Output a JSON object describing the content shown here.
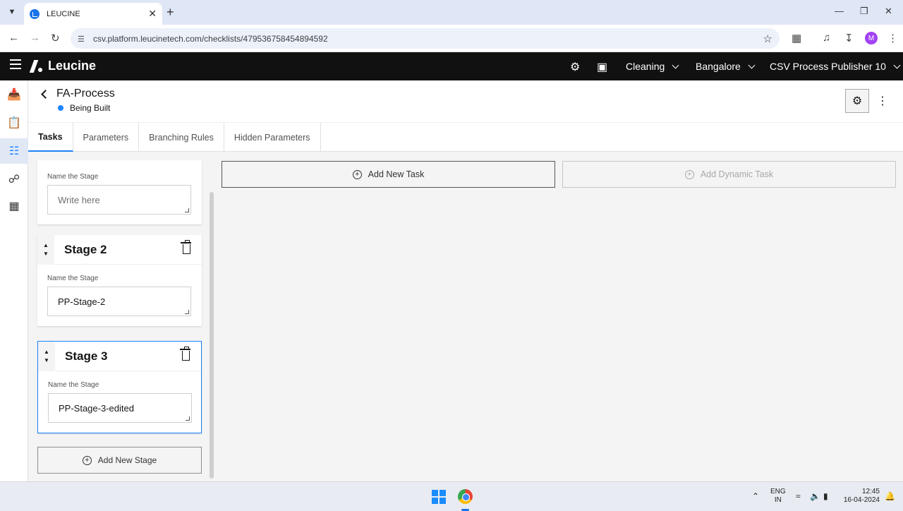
{
  "browser": {
    "tab_title": "LEUCINE",
    "url": "csv.platform.leucinetech.com/checklists/479536758454894592",
    "profile_initial": "M"
  },
  "app": {
    "logo_text": "Leucine",
    "header": {
      "use_case": "Cleaning",
      "facility": "Bangalore",
      "user": "CSV Process Publisher 10"
    }
  },
  "process": {
    "title": "FA-Process",
    "status": "Being Built",
    "status_color": "#1d84ff"
  },
  "tabs": [
    {
      "label": "Tasks",
      "active": true
    },
    {
      "label": "Parameters",
      "active": false
    },
    {
      "label": "Branching Rules",
      "active": false
    },
    {
      "label": "Hidden Parameters",
      "active": false
    }
  ],
  "stages": {
    "field_label": "Name the Stage",
    "items": [
      {
        "name": "",
        "value": "",
        "placeholder": "Write here"
      },
      {
        "name": "Stage 2",
        "value": "PP-Stage-2",
        "placeholder": ""
      },
      {
        "name": "Stage 3",
        "value": "PP-Stage-3-edited",
        "placeholder": "",
        "selected": true
      }
    ],
    "add_label": "Add New Stage"
  },
  "tasks": {
    "add_task_label": "Add New Task",
    "add_dynamic_label": "Add Dynamic Task"
  },
  "taskbar": {
    "lang_top": "ENG",
    "lang_bottom": "IN",
    "time": "12:45",
    "date": "16-04-2024"
  }
}
